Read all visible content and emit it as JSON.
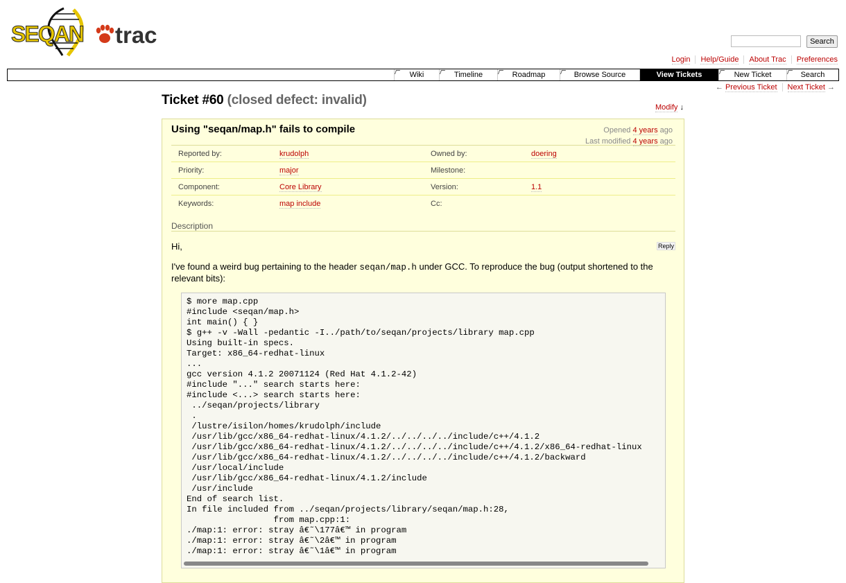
{
  "logo": {
    "brand": "SEQAN",
    "product": "trac"
  },
  "search": {
    "placeholder": "",
    "button": "Search"
  },
  "metanav": [
    "Login",
    "Help/Guide",
    "About Trac",
    "Preferences"
  ],
  "mainnav": [
    {
      "label": "Wiki",
      "active": false
    },
    {
      "label": "Timeline",
      "active": false
    },
    {
      "label": "Roadmap",
      "active": false
    },
    {
      "label": "Browse Source",
      "active": false
    },
    {
      "label": "View Tickets",
      "active": true
    },
    {
      "label": "New Ticket",
      "active": false
    },
    {
      "label": "Search",
      "active": false
    }
  ],
  "ctxtnav": {
    "prev_arrow": "←",
    "prev": "Previous Ticket",
    "next": "Next Ticket",
    "next_arrow": "→"
  },
  "ticket": {
    "number": "Ticket #60",
    "status": "(closed defect: invalid)",
    "modify": "Modify",
    "modify_arrow": "↓",
    "summary": "Using \"seqan/map.h\" fails to compile",
    "opened_prefix": "Opened",
    "opened_link": "4 years",
    "opened_suffix": "ago",
    "modified_prefix": "Last modified",
    "modified_link": "4 years",
    "modified_suffix": "ago",
    "properties": {
      "reported_by_label": "Reported by:",
      "reported_by": "krudolph",
      "owned_by_label": "Owned by:",
      "owned_by": "doering",
      "priority_label": "Priority:",
      "priority": "major",
      "milestone_label": "Milestone:",
      "milestone": "",
      "component_label": "Component:",
      "component": "Core Library",
      "version_label": "Version:",
      "version": "1.1",
      "keywords_label": "Keywords:",
      "keywords": "map include",
      "cc_label": "Cc:",
      "cc": ""
    },
    "description_label": "Description",
    "reply": "Reply",
    "greeting": "Hi,",
    "para_before": "I've found a weird bug pertaining to the header ",
    "para_code": "seqan/map.h",
    "para_after": " under GCC. To reproduce the bug (output shortened to the relevant bits):",
    "code_lines": [
      "$ more map.cpp",
      "#include <seqan/map.h>",
      "int main() { }",
      "$ g++ -v -Wall -pedantic -I../path/to/seqan/projects/library map.cpp",
      "Using built-in specs.",
      "Target: x86_64-redhat-linux",
      "...",
      "gcc version 4.1.2 20071124 (Red Hat 4.1.2-42)",
      "#include \"...\" search starts here:",
      "#include <...> search starts here:",
      " ../seqan/projects/library",
      " .",
      " /lustre/isilon/homes/krudolph/include",
      " /usr/lib/gcc/x86_64-redhat-linux/4.1.2/../../../../include/c++/4.1.2",
      " /usr/lib/gcc/x86_64-redhat-linux/4.1.2/../../../../include/c++/4.1.2/x86_64-redhat-linux",
      " /usr/lib/gcc/x86_64-redhat-linux/4.1.2/../../../../include/c++/4.1.2/backward",
      " /usr/local/include",
      " /usr/lib/gcc/x86_64-redhat-linux/4.1.2/include",
      " /usr/include",
      "End of search list.",
      "In file included from ../seqan/projects/library/seqan/map.h:28,",
      "                 from map.cpp:1:",
      "./map:1: error: stray â€˜\\177â€™ in program",
      "./map:1: error: stray â€˜\\2â€™ in program",
      "./map:1: error: stray â€˜\\1â€™ in program",
      "..."
    ]
  },
  "colors": {
    "link": "#bb0000",
    "ticket_bg": "#ffffdd",
    "nav_active": "#000000"
  }
}
